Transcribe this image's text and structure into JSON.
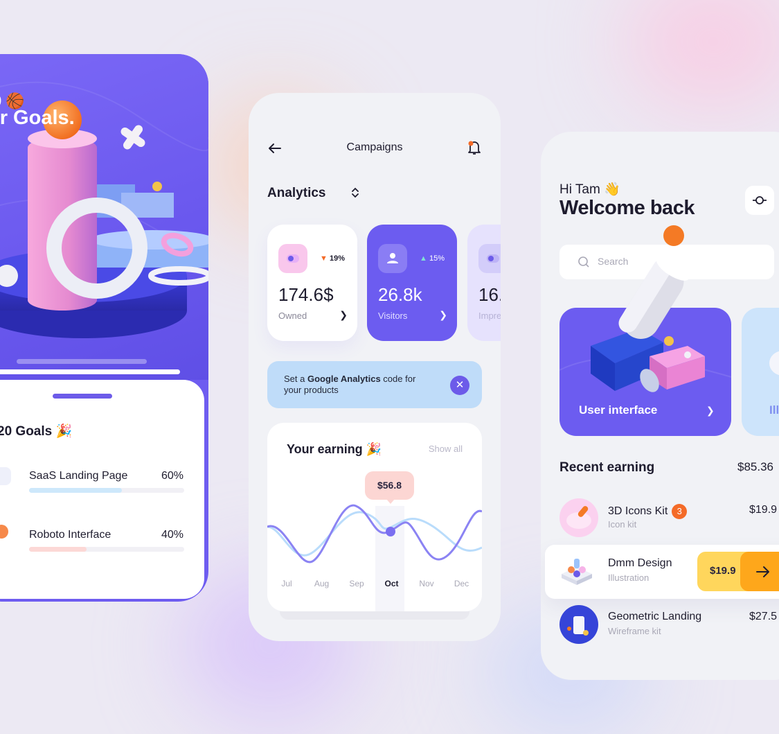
{
  "goals_screen": {
    "hero_year": "0",
    "hero_title": "ur Goals.",
    "sheet_title": "20 Goals",
    "goals": [
      {
        "name": "SaaS Landing Page",
        "percent": "60%",
        "progress": 0.6
      },
      {
        "name": "Roboto Interface",
        "percent": "40%",
        "progress": 0.4
      }
    ]
  },
  "campaigns_screen": {
    "title": "Campaigns",
    "section": "Analytics",
    "stats": [
      {
        "value": "174.6$",
        "label": "Owned",
        "change": "19%",
        "direction": "down"
      },
      {
        "value": "26.8k",
        "label": "Visitors",
        "change": "15%",
        "direction": "up"
      },
      {
        "value": "16.",
        "label": "Impre"
      }
    ],
    "banner": {
      "pre": "Set a ",
      "bold": "Google Analytics",
      "post": " code for your products"
    },
    "earning": {
      "title": "Your earning",
      "show_all": "Show all",
      "tooltip": "$56.8"
    }
  },
  "chart_data": {
    "type": "line",
    "categories": [
      "Jul",
      "Aug",
      "Sep",
      "Oct",
      "Nov",
      "Dec"
    ],
    "selected": "Oct",
    "highlight_value": 56.8
  },
  "home_screen": {
    "greeting": "Hi Tam",
    "headline": "Welcome back",
    "search_placeholder": "Search",
    "categories": [
      "User interface",
      "Ill"
    ],
    "recent_title": "Recent earning",
    "recent_total": "$85.36",
    "items": [
      {
        "name": "3D Icons Kit",
        "type": "Icon kit",
        "price": "$19.9",
        "badge": "3"
      },
      {
        "name": "Dmm Design",
        "type": "Illustration",
        "price": "$19.9"
      },
      {
        "name": "Geometric Landing",
        "type": "Wireframe kit",
        "price": "$27.5"
      }
    ]
  },
  "colors": {
    "primary": "#6c5be9",
    "accent_orange": "#f46b28",
    "accent_yellow": "#ffd65c"
  }
}
